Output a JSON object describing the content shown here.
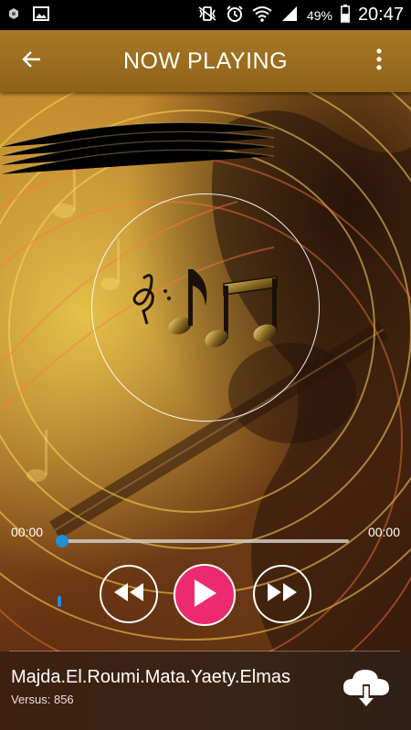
{
  "status_bar": {
    "battery": "49%",
    "time": "20:47",
    "icons": [
      "app-notification-icon",
      "image-notification-icon",
      "vibrate-icon",
      "alarm-icon",
      "wifi-icon",
      "signal-icon",
      "battery-icon"
    ]
  },
  "app_bar": {
    "title": "NOW PLAYING",
    "back_icon": "arrow-left-icon",
    "menu_icon": "more-vert-icon"
  },
  "player": {
    "album_art_icon": "music-notes-icon",
    "elapsed": "00:00",
    "duration": "00:00",
    "progress": 0,
    "controls": [
      "rewind-icon",
      "play-icon",
      "fast-forward-icon"
    ],
    "play_color": "#ee2a6e",
    "accent_color": "#1f8fd6"
  },
  "track": {
    "title": "Majda.El.Roumi.Mata.Yaety.Elmas",
    "subtitle": "Versus: 856",
    "download_icon": "cloud-download-icon"
  },
  "colors": {
    "app_bar": "#a87826",
    "bottom_panel": "#3d2010"
  }
}
